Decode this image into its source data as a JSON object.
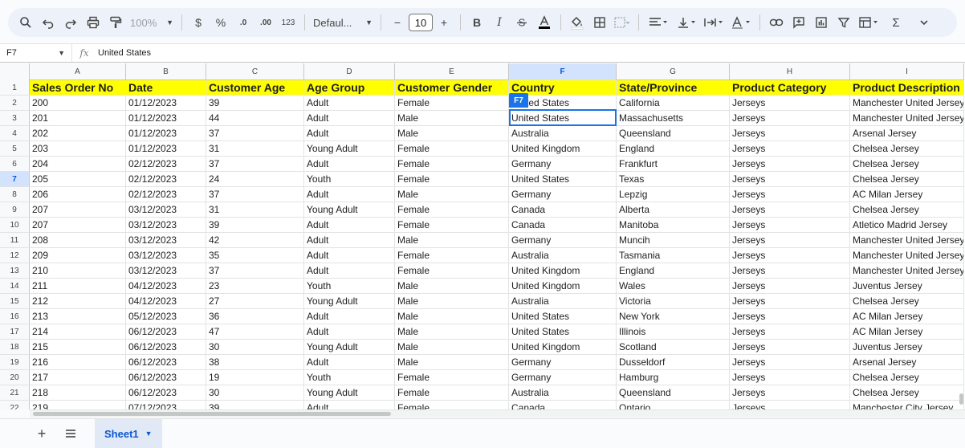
{
  "toolbar": {
    "zoom": "100%",
    "currency": "$",
    "percent": "%",
    "dec_less": ".0",
    "dec_more": ".00",
    "number_format": "123",
    "font": "Defaul...",
    "minus": "−",
    "font_size": "10",
    "plus": "+",
    "bold": "B",
    "italic": "I",
    "sigma": "Σ"
  },
  "formula_bar": {
    "cell_ref": "F7",
    "fx": "fx",
    "value": "United States"
  },
  "columns": [
    {
      "letter": "A"
    },
    {
      "letter": "B"
    },
    {
      "letter": "C"
    },
    {
      "letter": "D"
    },
    {
      "letter": "E"
    },
    {
      "letter": "F"
    },
    {
      "letter": "G"
    },
    {
      "letter": "H"
    },
    {
      "letter": "I"
    }
  ],
  "header_row": [
    "Sales Order No",
    "Date",
    "Customer Age",
    "Age Group",
    "Customer Gender",
    "Country",
    "State/Province",
    "Product Category",
    "Product Description"
  ],
  "rows": [
    [
      "200",
      "01/12/2023",
      "39",
      "Adult",
      "Female",
      "United States",
      "California",
      "Jerseys",
      "Manchester United Jersey"
    ],
    [
      "201",
      "01/12/2023",
      "44",
      "Adult",
      "Male",
      "United States",
      "Massachusetts",
      "Jerseys",
      "Manchester United Jersey"
    ],
    [
      "202",
      "01/12/2023",
      "37",
      " Adult",
      "Male",
      "Australia",
      "Queensland",
      "Jerseys",
      "Arsenal Jersey"
    ],
    [
      "203",
      "01/12/2023",
      "31",
      "Young Adult",
      "Female",
      "United Kingdom",
      "England",
      "Jerseys",
      "Chelsea Jersey"
    ],
    [
      "204",
      "02/12/2023",
      "37",
      "Adult",
      "Female",
      "Germany",
      "Frankfurt",
      "Jerseys",
      "Chelsea Jersey"
    ],
    [
      "205",
      "02/12/2023",
      "24",
      "Youth",
      "Female",
      "United States",
      "Texas",
      "Jerseys",
      "Chelsea Jersey"
    ],
    [
      "206",
      "02/12/2023",
      "37",
      "Adult",
      "Male",
      "Germany",
      "Lepzig",
      "Jerseys",
      "AC Milan Jersey"
    ],
    [
      "207",
      "03/12/2023",
      "31",
      "Young Adult",
      "Female",
      "Canada",
      "Alberta",
      "Jerseys",
      "Chelsea Jersey"
    ],
    [
      "207",
      "03/12/2023",
      "39",
      "Adult",
      "Female",
      "Canada",
      "Manitoba",
      "Jerseys",
      "Atletico Madrid Jersey"
    ],
    [
      "208",
      "03/12/2023",
      "42",
      "Adult",
      "Male",
      "Germany",
      "Muncih",
      "Jerseys",
      "Manchester United Jersey"
    ],
    [
      "209",
      "03/12/2023",
      "35",
      "Adult",
      "Female",
      "Australia",
      "Tasmania",
      "Jerseys",
      "Manchester United Jersey"
    ],
    [
      "210",
      "03/12/2023",
      "37",
      "Adult",
      "Female",
      "United Kingdom",
      "England",
      "Jerseys",
      "Manchester United Jersey"
    ],
    [
      "211",
      "04/12/2023",
      "23",
      "Youth",
      "Male",
      "United Kingdom",
      "Wales",
      "Jerseys",
      "Juventus Jersey"
    ],
    [
      "212",
      "04/12/2023",
      "27",
      "Young Adult",
      "Male",
      "Australia",
      "Victoria",
      "Jerseys",
      "Chelsea Jersey"
    ],
    [
      "213",
      "05/12/2023",
      "36",
      "Adult",
      "Male",
      "United States",
      "New York",
      "Jerseys",
      "AC Milan Jersey"
    ],
    [
      "214",
      "06/12/2023",
      "47",
      "Adult",
      "Male",
      "United States",
      "Illinois",
      "Jerseys",
      "AC Milan Jersey"
    ],
    [
      "215",
      "06/12/2023",
      "30",
      "Young Adult",
      "Male",
      "United Kingdom",
      "Scotland",
      "Jerseys",
      "Juventus Jersey"
    ],
    [
      "216",
      "06/12/2023",
      "38",
      "Adult",
      "Male",
      "Germany",
      "Dusseldorf",
      "Jerseys",
      "Arsenal Jersey"
    ],
    [
      "217",
      "06/12/2023",
      "19",
      "Youth",
      "Female",
      "Germany",
      "Hamburg",
      "Jerseys",
      "Chelsea Jersey"
    ],
    [
      "218",
      "06/12/2023",
      "30",
      "Young Adult",
      "Female",
      "Australia",
      "Queensland",
      "Jerseys",
      "Chelsea Jersey"
    ],
    [
      "219",
      "07/12/2023",
      "39",
      "Adult",
      "Female",
      "Canada",
      "Ontario",
      "Jerseys",
      "Manchester City Jersey"
    ]
  ],
  "active_tag": "F7",
  "sheet": {
    "add": "+",
    "name": "Sheet1"
  }
}
